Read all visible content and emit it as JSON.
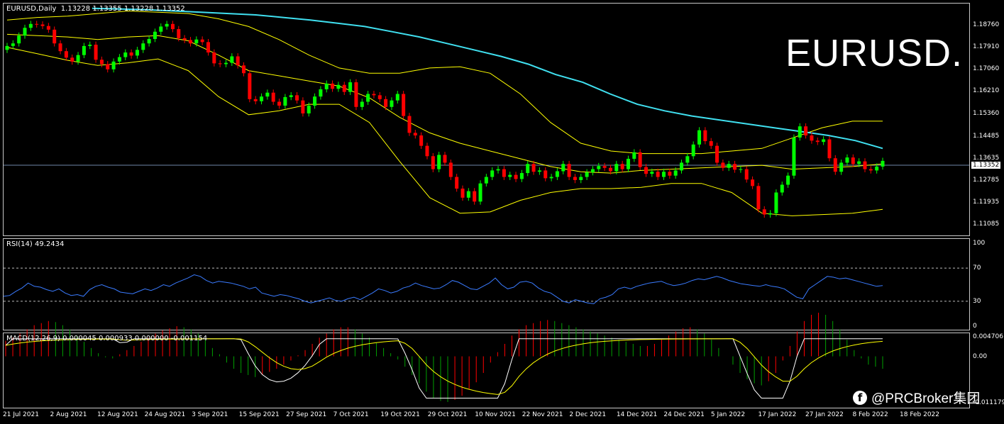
{
  "header": {
    "caption": "EURUSD,Daily  1.13228 1.13355 1.13228 1.13352",
    "symbol_big": "EURUSD."
  },
  "watermark": {
    "icon": "facebook-icon",
    "text": "@PRCBroker集团"
  },
  "colors": {
    "bull": "#00ff00",
    "bear": "#ff0000",
    "bands": "#ffff00",
    "ma": "#40e0f0",
    "rsi": "#3a7bff",
    "macd_up": "#ff0000",
    "macd_down": "#00a000",
    "macd_line": "#ffffff",
    "signal_line": "#ffff00"
  },
  "chart_data": [
    {
      "type": "candlestick",
      "title": "EURUSD,Daily",
      "ohlc_last": {
        "open": 1.13228,
        "high": 1.13355,
        "low": 1.13228,
        "close": 1.13352
      },
      "y_ticks": [
        "1.18760",
        "1.17910",
        "1.17060",
        "1.16210",
        "1.15360",
        "1.14485",
        "1.13635",
        "1.12785",
        "1.11935",
        "1.11085"
      ],
      "ylim": [
        1.107,
        1.1945
      ],
      "current_price": "1.13352",
      "x_ticks": [
        "21 Jul 2021",
        "2 Aug 2021",
        "12 Aug 2021",
        "24 Aug 2021",
        "3 Sep 2021",
        "15 Sep 2021",
        "27 Sep 2021",
        "7 Oct 2021",
        "19 Oct 2021",
        "29 Oct 2021",
        "10 Nov 2021",
        "22 Nov 2021",
        "2 Dec 2021",
        "14 Dec 2021",
        "24 Dec 2021",
        "5 Jan 2022",
        "17 Jan 2022",
        "27 Jan 2022",
        "8 Feb 2022",
        "18 Feb 2022"
      ],
      "closes": [
        1.1795,
        1.1805,
        1.1835,
        1.1865,
        1.188,
        1.1878,
        1.1872,
        1.1858,
        1.1805,
        1.1775,
        1.175,
        1.1735,
        1.176,
        1.1795,
        1.18,
        1.1742,
        1.1725,
        1.1705,
        1.1735,
        1.1752,
        1.177,
        1.1758,
        1.178,
        1.1805,
        1.1822,
        1.185,
        1.187,
        1.188,
        1.186,
        1.1825,
        1.1818,
        1.1805,
        1.182,
        1.181,
        1.177,
        1.1728,
        1.1725,
        1.173,
        1.1755,
        1.172,
        1.169,
        1.159,
        1.1582,
        1.16,
        1.1615,
        1.158,
        1.1565,
        1.1598,
        1.1605,
        1.1585,
        1.1535,
        1.1565,
        1.16,
        1.1628,
        1.165,
        1.163,
        1.1645,
        1.1618,
        1.1655,
        1.156,
        1.158,
        1.161,
        1.1605,
        1.159,
        1.156,
        1.1585,
        1.161,
        1.1525,
        1.146,
        1.145,
        1.141,
        1.137,
        1.132,
        1.1375,
        1.1345,
        1.129,
        1.1245,
        1.121,
        1.1235,
        1.1195,
        1.1265,
        1.129,
        1.1315,
        1.132,
        1.129,
        1.1298,
        1.1282,
        1.1305,
        1.134,
        1.131,
        1.1315,
        1.1285,
        1.129,
        1.1312,
        1.134,
        1.129,
        1.1278,
        1.129,
        1.1308,
        1.132,
        1.1332,
        1.1325,
        1.1312,
        1.134,
        1.132,
        1.136,
        1.1385,
        1.1328,
        1.1302,
        1.131,
        1.129,
        1.131,
        1.1295,
        1.1315,
        1.1345,
        1.137,
        1.1415,
        1.147,
        1.1428,
        1.141,
        1.1345,
        1.1325,
        1.134,
        1.1318,
        1.132,
        1.128,
        1.1255,
        1.1165,
        1.1145,
        1.115,
        1.123,
        1.126,
        1.1295,
        1.1442,
        1.1485,
        1.145,
        1.143,
        1.1425,
        1.1435,
        1.1362,
        1.131,
        1.1345,
        1.1365,
        1.134,
        1.135,
        1.132,
        1.1315,
        1.133,
        1.1352
      ],
      "ma_series": [
        1.194,
        1.1938,
        1.1935,
        1.193,
        1.1925,
        1.192,
        1.1915,
        1.1905,
        1.1895,
        1.1883,
        1.187,
        1.185,
        1.183,
        1.1805,
        1.178,
        1.1755,
        1.1725,
        1.1685,
        1.1655,
        1.161,
        1.157,
        1.1545,
        1.1525,
        1.151,
        1.1495,
        1.148,
        1.1465,
        1.145,
        1.143,
        1.14
      ],
      "upper_band": [
        1.1895,
        1.1905,
        1.191,
        1.192,
        1.193,
        1.1925,
        1.192,
        1.19,
        1.187,
        1.182,
        1.176,
        1.171,
        1.169,
        1.169,
        1.171,
        1.1715,
        1.169,
        1.161,
        1.15,
        1.142,
        1.139,
        1.138,
        1.138,
        1.138,
        1.139,
        1.14,
        1.144,
        1.148,
        1.1505,
        1.1505
      ],
      "lower_band": [
        1.179,
        1.1765,
        1.174,
        1.172,
        1.173,
        1.1745,
        1.17,
        1.16,
        1.153,
        1.1545,
        1.157,
        1.157,
        1.15,
        1.135,
        1.121,
        1.115,
        1.1155,
        1.12,
        1.123,
        1.1245,
        1.1245,
        1.125,
        1.1265,
        1.1265,
        1.123,
        1.115,
        1.114,
        1.1145,
        1.115,
        1.1165
      ],
      "middle_band": [
        1.184,
        1.1835,
        1.183,
        1.182,
        1.183,
        1.1835,
        1.1815,
        1.176,
        1.17,
        1.168,
        1.166,
        1.164,
        1.1595,
        1.152,
        1.146,
        1.142,
        1.139,
        1.136,
        1.133,
        1.131,
        1.1305,
        1.1315,
        1.132,
        1.1325,
        1.133,
        1.1335,
        1.132,
        1.1325,
        1.133,
        1.134
      ]
    },
    {
      "type": "line",
      "title": "RSI(14) 49.2434",
      "y_ticks": [
        "100",
        "70",
        "30",
        "0"
      ],
      "ylim": [
        0,
        100
      ],
      "levels": [
        70,
        30
      ],
      "values": [
        36,
        37,
        42,
        46,
        52,
        48,
        47,
        44,
        42,
        45,
        40,
        37,
        38,
        36,
        44,
        48,
        50,
        47,
        45,
        41,
        40,
        39,
        42,
        45,
        43,
        46,
        50,
        48,
        52,
        55,
        58,
        62,
        60,
        55,
        52,
        54,
        53,
        52,
        50,
        48,
        45,
        47,
        40,
        38,
        36,
        38,
        37,
        35,
        33,
        30,
        28,
        30,
        32,
        34,
        31,
        30,
        33,
        35,
        32,
        36,
        40,
        45,
        43,
        40,
        42,
        46,
        48,
        52,
        49,
        47,
        45,
        46,
        50,
        55,
        53,
        49,
        45,
        44,
        48,
        52,
        58,
        50,
        45,
        47,
        53,
        54,
        52,
        46,
        42,
        40,
        35,
        30,
        28,
        32,
        30,
        28,
        27,
        33,
        35,
        38,
        45,
        47,
        45,
        48,
        50,
        52,
        53,
        54,
        51,
        49,
        50,
        52,
        55,
        57,
        56,
        58,
        60,
        58,
        55,
        53,
        51,
        50,
        49,
        48,
        50,
        48,
        47,
        45,
        40,
        35,
        33,
        45,
        50,
        55,
        60,
        59,
        57,
        58,
        56,
        54,
        52,
        50,
        48,
        49
      ],
      "last_value": 49.2434
    },
    {
      "type": "bar",
      "title": "MACD(12,26,9) 0.000045 0.000933 0.000000 -0.001154",
      "y_ticks": [
        "0.004706",
        "0.00",
        "-0.011179"
      ],
      "ylim": [
        -0.011179,
        0.004706
      ],
      "histogram": [
        0.0015,
        0.0018,
        0.0022,
        0.0026,
        0.003,
        0.0032,
        0.0034,
        0.0033,
        0.003,
        0.0026,
        0.002,
        0.0014,
        0.0008,
        0.0003,
        -0.0001,
        -0.0002,
        0.0002,
        0.0006,
        0.001,
        0.0014,
        0.0018,
        0.0022,
        0.0025,
        0.0027,
        0.0029,
        0.0028,
        0.0026,
        0.0022,
        0.0016,
        0.0008,
        0.0002,
        -0.0006,
        -0.0012,
        -0.0016,
        -0.0018,
        -0.002,
        -0.0018,
        -0.0015,
        -0.0012,
        -0.0008,
        -0.0004,
        0.0001,
        0.0006,
        0.0012,
        0.0018,
        0.0022,
        0.0026,
        0.0028,
        0.0028,
        0.0026,
        0.0022,
        0.0018,
        0.0013,
        0.0008,
        0.0003,
        -0.0003,
        -0.001,
        -0.0018,
        -0.0026,
        -0.0034,
        -0.004,
        -0.0043,
        -0.0044,
        -0.0042,
        -0.0038,
        -0.0032,
        -0.0025,
        -0.0016,
        -0.0006,
        0.0004,
        0.0012,
        0.002,
        0.0026,
        0.003,
        0.0032,
        0.0034,
        0.0035,
        0.0034,
        0.0032,
        0.003,
        0.0028,
        0.0026,
        0.0024,
        0.0022,
        0.002,
        0.0018,
        0.0016,
        0.0014,
        0.0012,
        0.001,
        0.001,
        0.0012,
        0.0016,
        0.002,
        0.0024,
        0.0027,
        0.0028,
        0.0026,
        0.0022,
        0.0016,
        0.0008,
        0.0,
        -0.0008,
        -0.0016,
        -0.0022,
        -0.0026,
        -0.0028,
        -0.0024,
        -0.0016,
        -0.0004,
        0.001,
        0.0024,
        0.0034,
        0.004,
        0.0042,
        0.004,
        0.0034,
        0.0026,
        0.0016,
        0.0006,
        -0.0002,
        -0.0008,
        -0.001,
        -0.0012
      ]
    }
  ]
}
